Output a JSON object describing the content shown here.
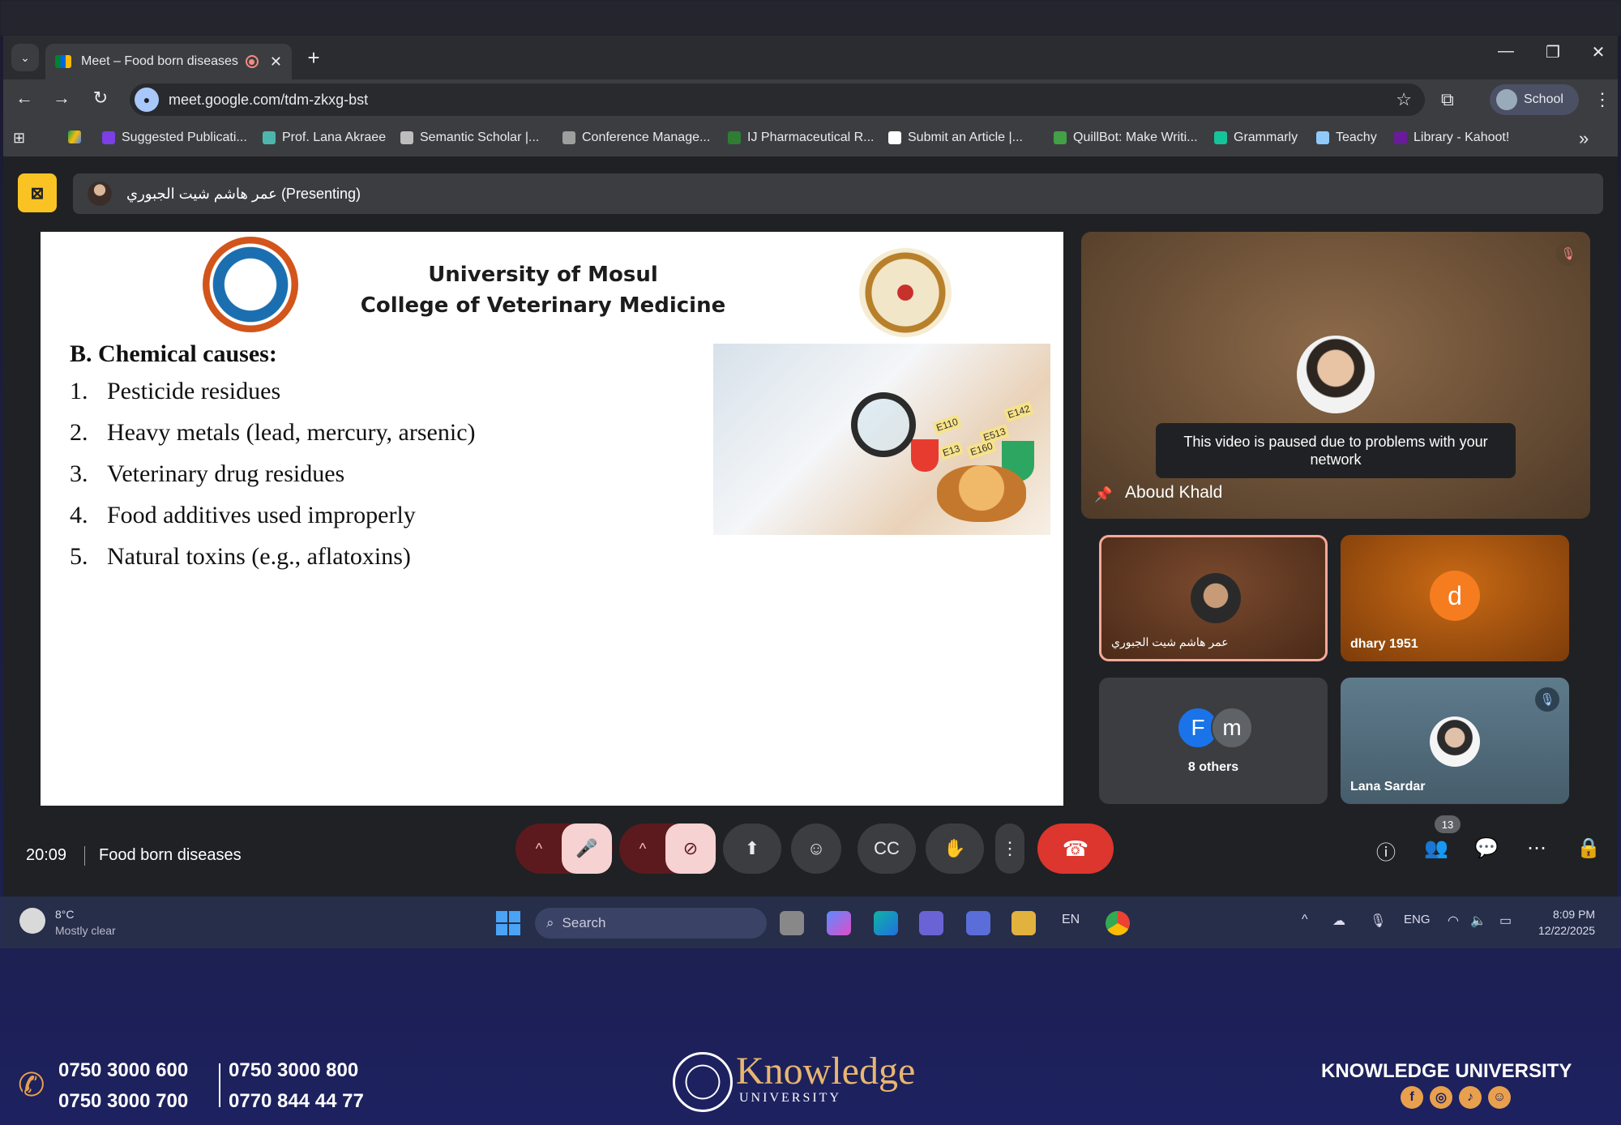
{
  "browser": {
    "tab_title": "Meet – Food born diseases",
    "tab_close": "✕",
    "new_tab": "+",
    "url": "meet.google.com/tdm-zkxg-bst",
    "profile_label": "School",
    "window_controls": {
      "minimize": "—",
      "restore": "❐",
      "close": "✕"
    },
    "bookmarks": [
      {
        "label": "Suggested Publicati...",
        "color": "#7b3fe4"
      },
      {
        "label": "Prof. Lana Akraee",
        "color": "#4db6ac"
      },
      {
        "label": "Semantic Scholar |...",
        "color": "#bdbdbd"
      },
      {
        "label": "Conference Manage...",
        "color": "#9e9e9e"
      },
      {
        "label": "IJ Pharmaceutical R...",
        "color": "#2e7d32"
      },
      {
        "label": "Submit an Article |...",
        "color": "#ffffff"
      },
      {
        "label": "QuillBot: Make Writi...",
        "color": "#43a047"
      },
      {
        "label": "Grammarly",
        "color": "#15c39a"
      },
      {
        "label": "Teachy",
        "color": "#90caf9"
      },
      {
        "label": "Library - Kahoot!",
        "color": "#6a1b9a"
      }
    ]
  },
  "meet": {
    "presenter_label": "عمر هاشم شيت الجبوري (Presenting)",
    "slide": {
      "title_line1": "University of Mosul",
      "title_line2": "College of Veterinary Medicine",
      "heading": "B. Chemical causes:",
      "items": [
        {
          "num": "1.",
          "text": "Pesticide residues"
        },
        {
          "num": "2.",
          "text": "Heavy metals (lead, mercury, arsenic)"
        },
        {
          "num": "3.",
          "text": "Veterinary drug residues"
        },
        {
          "num": "4.",
          "text": "Food additives used improperly"
        },
        {
          "num": "5.",
          "text": "Natural toxins (e.g., aflatoxins)"
        }
      ],
      "image_tags": [
        "E110",
        "E142",
        "E513",
        "E160",
        "E13"
      ]
    },
    "main_tile": {
      "name": "Aboud Khald",
      "notice": "This video is paused due to problems with your network"
    },
    "tiles": [
      {
        "name": "عمر هاشم شيت الجبوري"
      },
      {
        "name": "dhary 1951",
        "initial": "d"
      },
      {
        "name": "8 others",
        "initials": [
          "F",
          "m"
        ]
      },
      {
        "name": "Lana Sardar"
      }
    ],
    "time": "20:09",
    "meeting_title": "Food born diseases",
    "participant_count": "13"
  },
  "taskbar": {
    "temperature": "8°C",
    "weather": "Mostly clear",
    "search_placeholder": "Search",
    "lang_short": "EN",
    "lang": "ENG",
    "time": "8:09 PM",
    "date": "12/22/2025"
  },
  "footer": {
    "phones_left": [
      "0750 3000 600",
      "0750 3000 700"
    ],
    "phones_right": [
      "0750 3000 800",
      "0770 844 44 77"
    ],
    "brand": "Knowledge",
    "brand_sub": "UNIVERSITY",
    "right_title": "KNOWLEDGE UNIVERSITY"
  }
}
